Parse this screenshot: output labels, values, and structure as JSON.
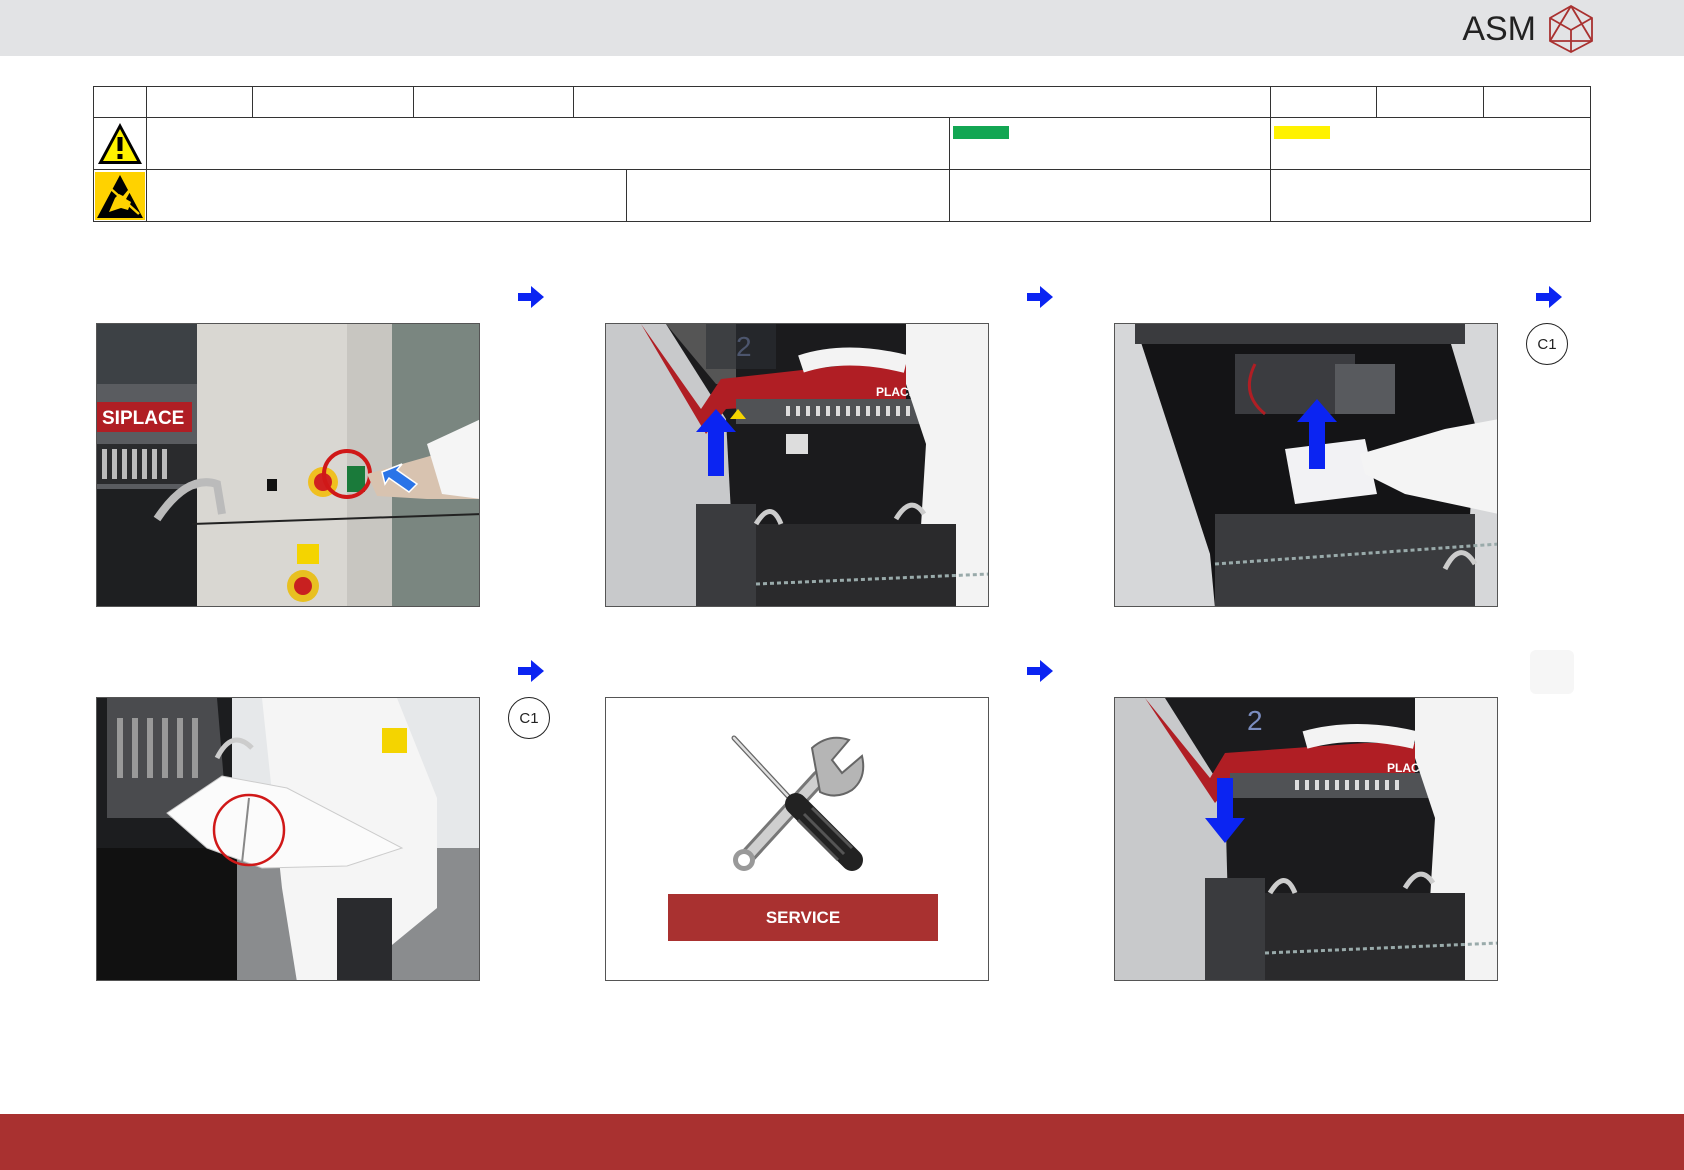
{
  "header": {
    "logo_text": "ASM"
  },
  "colors": {
    "accent_red": "#a93130",
    "green_status": "#12a653",
    "yellow_status": "#fff200",
    "step_arrow": "#0b24f2"
  },
  "icons": {
    "warning": "warning-triangle-icon",
    "esd": "esd-hand-icon",
    "next_step": "arrow-right-icon",
    "arrow_up": "arrow-up-icon",
    "arrow_down": "arrow-down-icon",
    "tools": "wrench-screwdriver-icon"
  },
  "steps": [
    {
      "image": "machine-front-switch-photo",
      "arrow": "arrow-right-icon",
      "ref": ""
    },
    {
      "image": "lift-hood-photo",
      "arrow": "arrow-right-icon",
      "ref": ""
    },
    {
      "image": "insert-paper-photo",
      "arrow": "arrow-right-icon",
      "ref": "C1"
    },
    {
      "image": "remove-paper-photo",
      "arrow": "arrow-right-icon",
      "ref": "C1"
    },
    {
      "image": "service-card",
      "arrow": "arrow-right-icon",
      "ref": "",
      "label": "SERVICE"
    },
    {
      "image": "lower-hood-photo",
      "arrow": "",
      "ref": ""
    }
  ],
  "photo_text": {
    "brand": "SIPLACE",
    "brand_partial": "PLACE",
    "station_number": "2"
  }
}
